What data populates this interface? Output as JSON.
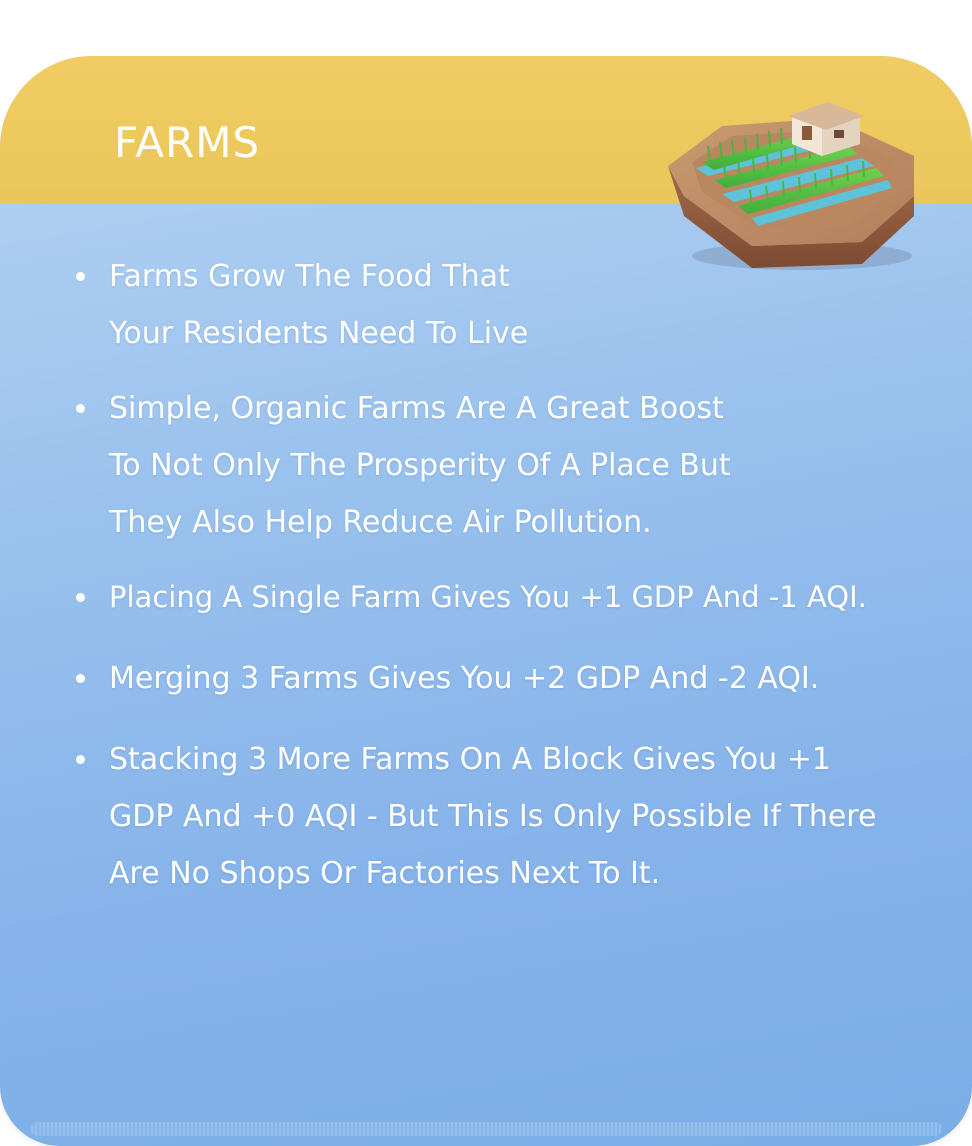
{
  "card": {
    "title": "FARMS",
    "accent_header_color": "#EEC95E",
    "body_color": "#8DB9EC"
  },
  "illustration": {
    "icon": "farm-tile-icon"
  },
  "bullets": [
    {
      "lines": [
        "Farms Grow The Food That",
        "Your Residents Need To Live"
      ]
    },
    {
      "lines": [
        "Simple, Organic Farms Are A Great Boost",
        "To Not Only The Prosperity Of A Place But",
        "They Also Help Reduce Air Pollution."
      ]
    },
    {
      "lines": [
        "Placing A Single Farm Gives You +1 GDP And -1 AQI."
      ]
    },
    {
      "lines": [
        "Merging 3 Farms Gives You +2 GDP And -2 AQI."
      ]
    },
    {
      "lines": [
        "Stacking 3 More Farms On A Block Gives You +1",
        "GDP And +0 AQI - But This Is Only Possible If There",
        "Are No Shops Or Factories Next To It."
      ]
    }
  ]
}
